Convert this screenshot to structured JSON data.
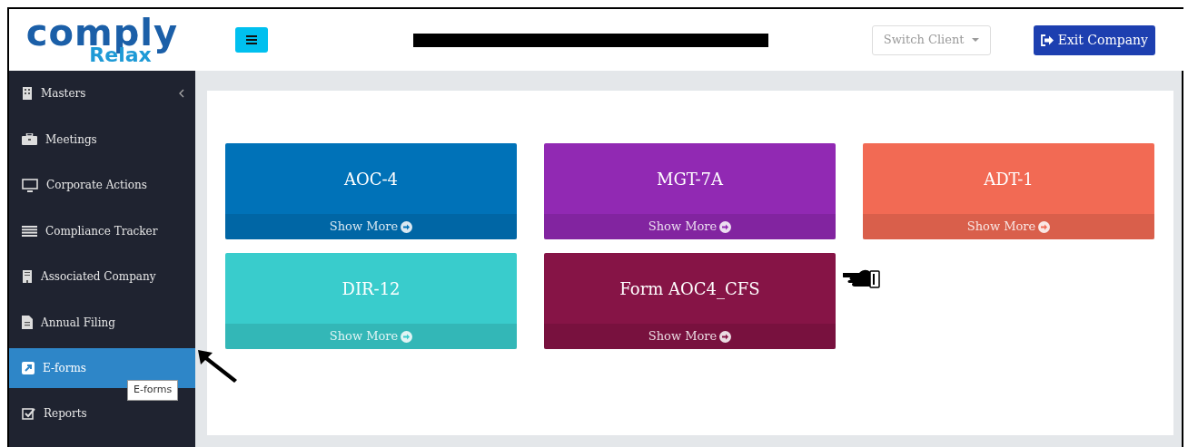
{
  "logo": {
    "line_1": "comply",
    "line_2": "Relax"
  },
  "header": {
    "switch_client": "Switch Client",
    "exit_button": "Exit Company"
  },
  "sidebar": {
    "items": [
      {
        "label": "Masters",
        "selected": false,
        "has_submenu": true
      },
      {
        "label": "Meetings",
        "selected": false,
        "has_submenu": false
      },
      {
        "label": "Corporate Actions",
        "selected": false,
        "has_submenu": false
      },
      {
        "label": "Compliance Tracker",
        "selected": false,
        "has_submenu": false
      },
      {
        "label": "Associated Company",
        "selected": false,
        "has_submenu": false
      },
      {
        "label": "Annual Filing",
        "selected": false,
        "has_submenu": false
      },
      {
        "label": "E-forms",
        "selected": true,
        "has_submenu": false
      },
      {
        "label": "Reports",
        "selected": false,
        "has_submenu": false
      }
    ]
  },
  "tooltip": {
    "text": "E-forms"
  },
  "tiles": [
    {
      "title": "AOC-4",
      "footer": "Show More",
      "color": "#0072b8"
    },
    {
      "title": "MGT-7A",
      "footer": "Show More",
      "color": "#9129b3"
    },
    {
      "title": "ADT-1",
      "footer": "Show More",
      "color": "#f26a54"
    },
    {
      "title": "DIR-12",
      "footer": "Show More",
      "color": "#39cccc"
    },
    {
      "title": "Form AOC4_CFS",
      "footer": "Show More",
      "color": "#861446"
    }
  ]
}
